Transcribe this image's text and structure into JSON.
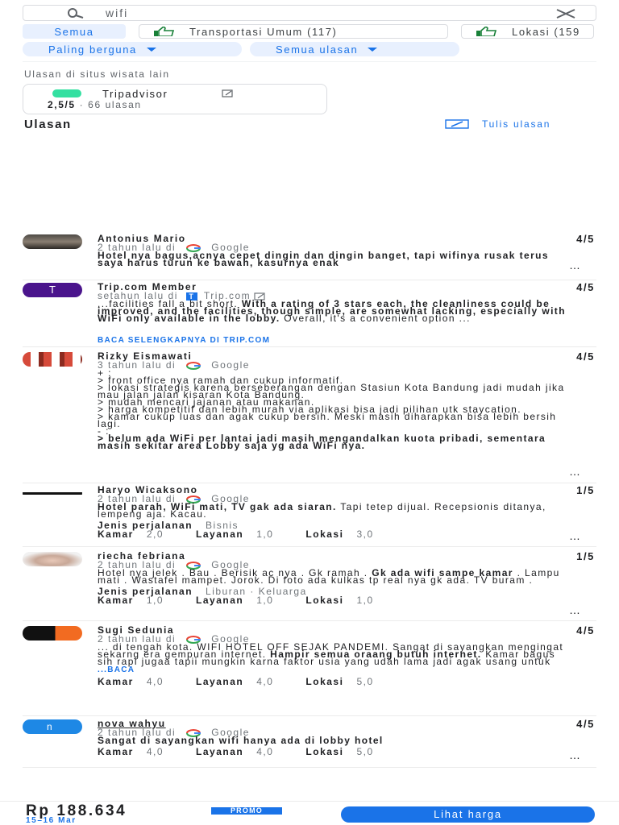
{
  "search": {
    "value": "wifi"
  },
  "chips": [
    {
      "label": "Semua"
    },
    {
      "label": "Transportasi Umum (117)"
    },
    {
      "label": "Lokasi (159"
    }
  ],
  "sort": {
    "sort_label": "Paling berguna",
    "filter_label": "Semua ulasan"
  },
  "other_sites": {
    "heading": "Ulasan di situs wisata lain",
    "site_name": "Tripadvisor",
    "score": "2,5/5",
    "count": "· 66 ulasan"
  },
  "reviews_section": {
    "title": "Ulasan",
    "write_label": "Tulis ulasan"
  },
  "reviews": [
    {
      "name": "Antonius Mario",
      "when": "2 tahun lalu di",
      "source": "Google",
      "score": "4/5",
      "body_bold": "Hotel nya bagus,acnya cepet dingin dan dingin banget, tapi wifinya rusak terus saya harus turun ke bawah, kasurnya enak"
    },
    {
      "name": "Trip.com Member",
      "when": "setahun lalu di",
      "source": "Trip.com",
      "score": "4/5",
      "body_prefix": "...facilities fall a bit short. ",
      "body_bold": "With a rating of 3 stars each, the cleanliness could be improved, and the facilities, though simple, are somewhat lacking, especially with WiFi only available in the lobby.",
      "body_suffix": " Overall, it's a convenient option ...",
      "link": "BACA SELENGKAPNYA DI TRIP.COM"
    },
    {
      "name": "Rizky Eismawati",
      "when": "3 tahun lalu di",
      "source": "Google",
      "score": "4/5",
      "lines": [
        "+ :",
        "> front office nya ramah dan cukup informatif.",
        "> lokasi strategis karena berseberangan dengan Stasiun Kota Bandung jadi mudah jika mau jalan jalan kisaran Kota Bandung.",
        "> mudah mencari jajanan atau makanan.",
        "> harga kompetitif dan lebih murah via aplikasi bisa jadi pilihan utk staycation.",
        "> kamar cukup luas dan agak cukup bersih. Meski masih diharapkan bisa lebih bersih lagi.",
        "- :"
      ],
      "body_bold": "> belum ada WiFi per lantai jadi masih mengandalkan kuota pribadi, sementara masih sekitar area Lobby saja yg ada WiFi nya."
    },
    {
      "name": "Haryo Wicaksono",
      "when": "2 tahun lalu di",
      "source": "Google",
      "score": "1/5",
      "body_bold": "Hotel parah, WiFi mati, TV gak ada siaran.",
      "body_suffix": " Tapi tetep dijual. Recepsionis ditanya, lempeng aja. Kacau.",
      "trip_label": "Jenis perjalanan",
      "trip_value": "Bisnis",
      "ratings": [
        {
          "label": "Kamar",
          "value": "2,0"
        },
        {
          "label": "Layanan",
          "value": "1,0"
        },
        {
          "label": "Lokasi",
          "value": "3,0"
        }
      ]
    },
    {
      "name": "riecha febriana",
      "when": "2 tahun lalu di",
      "source": "Google",
      "score": "1/5",
      "body_prefix": "Hotel nya jelek . Bau . Berisik ac nya . Gk ramah . ",
      "body_bold": "Gk ada wifi sampe kamar",
      "body_suffix": " . Lampu mati . Wastafel mampet. Jorok. Di foto ada kulkas tp real nya gk ada. TV buram .",
      "trip_label": "Jenis perjalanan",
      "trip_value": "Liburan · Keluarga",
      "ratings": [
        {
          "label": "Kamar",
          "value": "1,0"
        },
        {
          "label": "Layanan",
          "value": "1,0"
        },
        {
          "label": "Lokasi",
          "value": "1,0"
        }
      ]
    },
    {
      "name": "Sugi Sedunia",
      "when": "2 tahun lalu di",
      "source": "Google",
      "score": "4/5",
      "body_prefix": "... di tengah kota. WIFI HOTEL OFF SEJAK PANDEMI. Sangat di sayangkan mengingat sekarng era gempuran internet. ",
      "body_bold": "Hampir semua oraang butuh internet.",
      "body_suffix": " Kamar bagus sih rapi jugaa tapii mungkin karna faktor usia yang udah lama jadi agak usang untuk ",
      "more_link": "...BACA",
      "ratings": [
        {
          "label": "Kamar",
          "value": "4,0"
        },
        {
          "label": "Layanan",
          "value": "4,0"
        },
        {
          "label": "Lokasi",
          "value": "5,0"
        }
      ]
    },
    {
      "name": "nova wahyu",
      "when": "2 tahun lalu di",
      "source": "Google",
      "score": "4/5",
      "body_bold": "Sangat di sayangkan wifi hanya ada di lobby hotel",
      "ratings": [
        {
          "label": "Kamar",
          "value": "4,0"
        },
        {
          "label": "Layanan",
          "value": "4,0"
        },
        {
          "label": "Lokasi",
          "value": "5,0"
        }
      ]
    }
  ],
  "bottom": {
    "price": "Rp 188.634",
    "badge": "PROMO",
    "dates": "15–16 Mar",
    "cta": "Lihat harga"
  },
  "colors": {
    "accent": "#1a73e8",
    "tripadvisor": "#34e0a1",
    "trip_avatar": "#4a148c",
    "nova_avatar": "#1e88e5"
  }
}
